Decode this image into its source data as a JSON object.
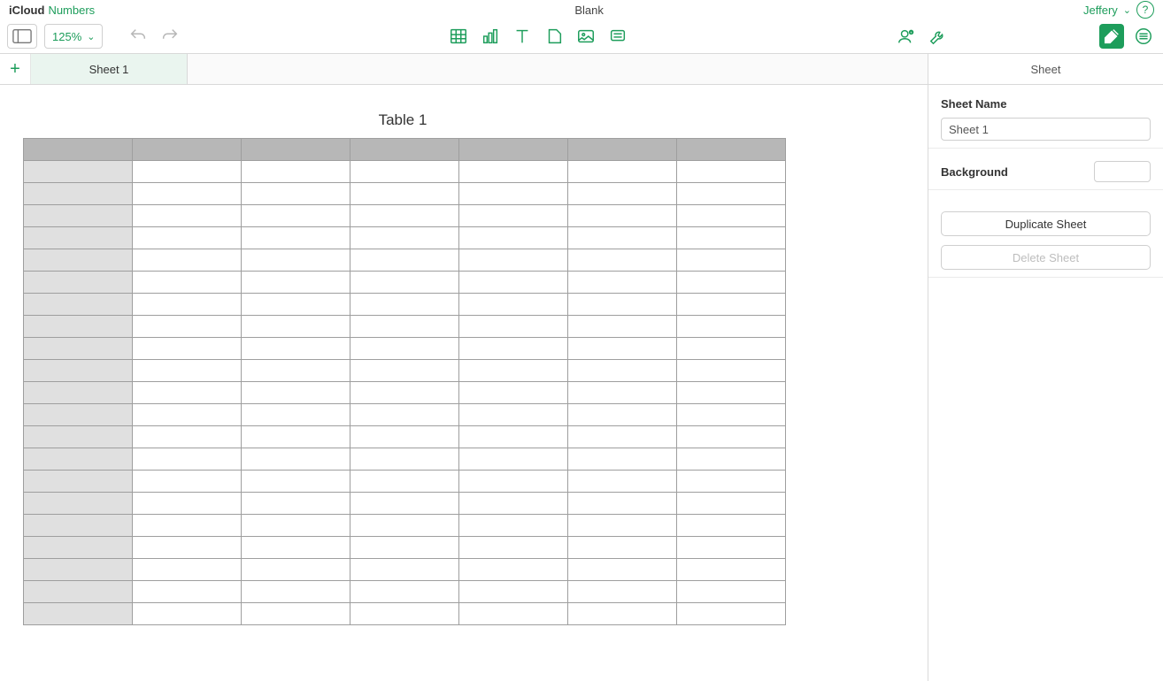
{
  "header": {
    "brand_icloud": "iCloud",
    "brand_app": "Numbers",
    "document_title": "Blank",
    "user_name": "Jeffery"
  },
  "toolbar": {
    "zoom_level": "125%"
  },
  "tabs": {
    "sheet_tab": "Sheet 1"
  },
  "table": {
    "title": "Table 1",
    "columns": 7,
    "rows": 22
  },
  "inspector": {
    "panel_title": "Sheet",
    "sheet_name_label": "Sheet Name",
    "sheet_name_value": "Sheet 1",
    "background_label": "Background",
    "background_color": "#ffffff",
    "duplicate_label": "Duplicate Sheet",
    "delete_label": "Delete Sheet"
  }
}
